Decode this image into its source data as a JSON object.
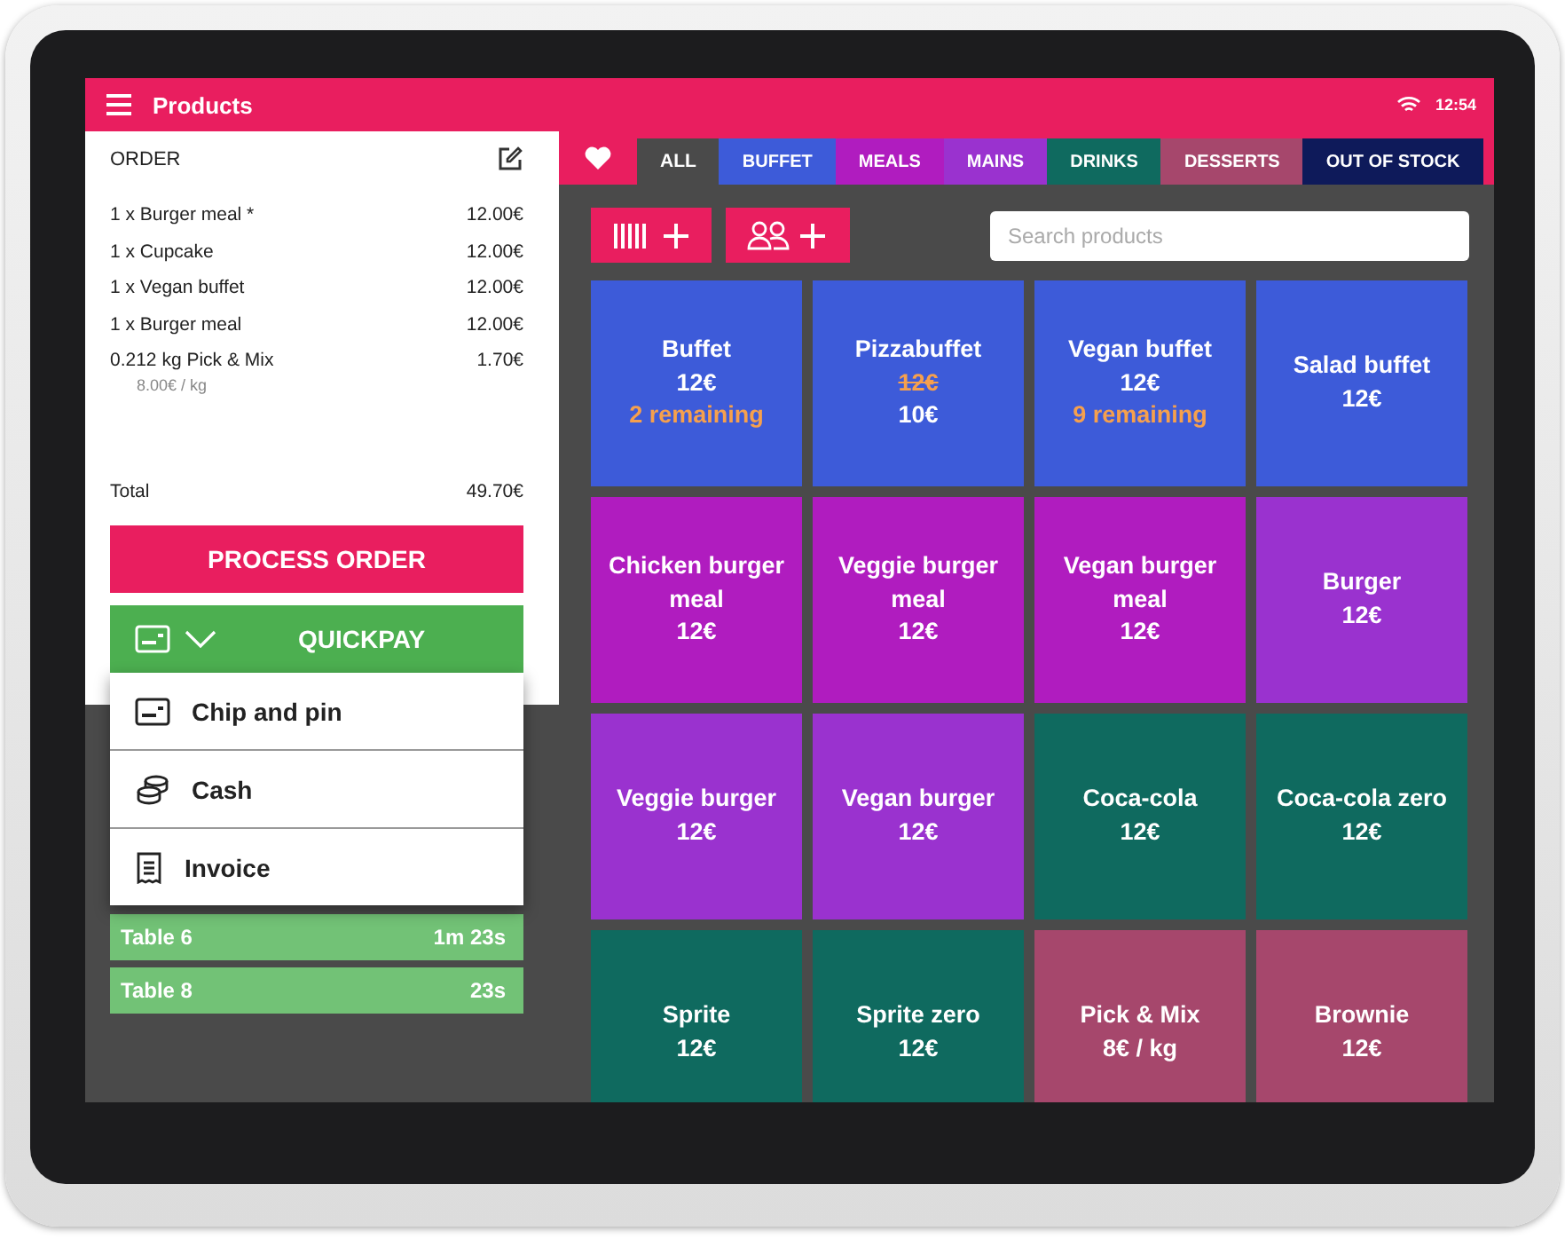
{
  "top_bar": {
    "title": "Products",
    "time": "12:54"
  },
  "order": {
    "title": "ORDER",
    "items": [
      {
        "name": "1 x Burger meal *",
        "price": "12.00€"
      },
      {
        "name": "1 x Cupcake",
        "price": "12.00€"
      },
      {
        "name": "1 x Vegan buffet",
        "price": "12.00€"
      },
      {
        "name": "1 x Burger meal",
        "price": "12.00€"
      },
      {
        "name": "0.212 kg Pick & Mix",
        "price": "1.70€",
        "note": "8.00€ / kg"
      }
    ],
    "total_label": "Total",
    "total": "49.70€",
    "process_button": "PROCESS ORDER",
    "quickpay_button": "QUICKPAY"
  },
  "payment_menu": [
    {
      "kind": "card",
      "label": "Chip and pin"
    },
    {
      "kind": "cash",
      "label": "Cash"
    },
    {
      "kind": "invoice",
      "label": "Invoice"
    }
  ],
  "tables": [
    {
      "name": "Table 6",
      "time": "1m 23s"
    },
    {
      "name": "Table 8",
      "time": "23s"
    }
  ],
  "tabs": [
    {
      "label": "ALL",
      "color": "#4a4a4a",
      "selected": true
    },
    {
      "label": "BUFFET",
      "color": "#3d5bd9",
      "selected": false
    },
    {
      "label": "MEALS",
      "color": "#b01cbf",
      "selected": false
    },
    {
      "label": "MAINS",
      "color": "#9a32cf",
      "selected": false
    },
    {
      "label": "DRINKS",
      "color": "#0f6a5f",
      "selected": false
    },
    {
      "label": "DESSERTS",
      "color": "#a6476c",
      "selected": false
    },
    {
      "label": "OUT OF STOCK",
      "color": "#0e1a5a",
      "selected": false
    }
  ],
  "search": {
    "placeholder": "Search products"
  },
  "products": [
    {
      "name": "Buffet",
      "price": "12€",
      "note": "2 remaining",
      "color": "#3d5bd9"
    },
    {
      "name": "Pizzabuffet",
      "old_price": "12€",
      "price": "10€",
      "color": "#3d5bd9"
    },
    {
      "name": "Vegan buffet",
      "price": "12€",
      "note": "9 remaining",
      "color": "#3d5bd9"
    },
    {
      "name": "Salad buffet",
      "price": "12€",
      "color": "#3d5bd9"
    },
    {
      "name": "Chicken burger meal",
      "price": "12€",
      "color": "#b01cbf"
    },
    {
      "name": "Veggie burger meal",
      "price": "12€",
      "color": "#b01cbf"
    },
    {
      "name": "Vegan burger meal",
      "price": "12€",
      "color": "#b01cbf"
    },
    {
      "name": "Burger",
      "price": "12€",
      "color": "#9a32cf"
    },
    {
      "name": "Veggie burger",
      "price": "12€",
      "color": "#9a32cf"
    },
    {
      "name": "Vegan burger",
      "price": "12€",
      "color": "#9a32cf"
    },
    {
      "name": "Coca-cola",
      "price": "12€",
      "color": "#0f6a5f"
    },
    {
      "name": "Coca-cola zero",
      "price": "12€",
      "color": "#0f6a5f"
    },
    {
      "name": "Sprite",
      "price": "12€",
      "color": "#0f6a5f"
    },
    {
      "name": "Sprite zero",
      "price": "12€",
      "color": "#0f6a5f"
    },
    {
      "name": "Pick & Mix",
      "price": "8€ / kg",
      "color": "#a6476c"
    },
    {
      "name": "Brownie",
      "price": "12€",
      "color": "#a6476c"
    }
  ]
}
